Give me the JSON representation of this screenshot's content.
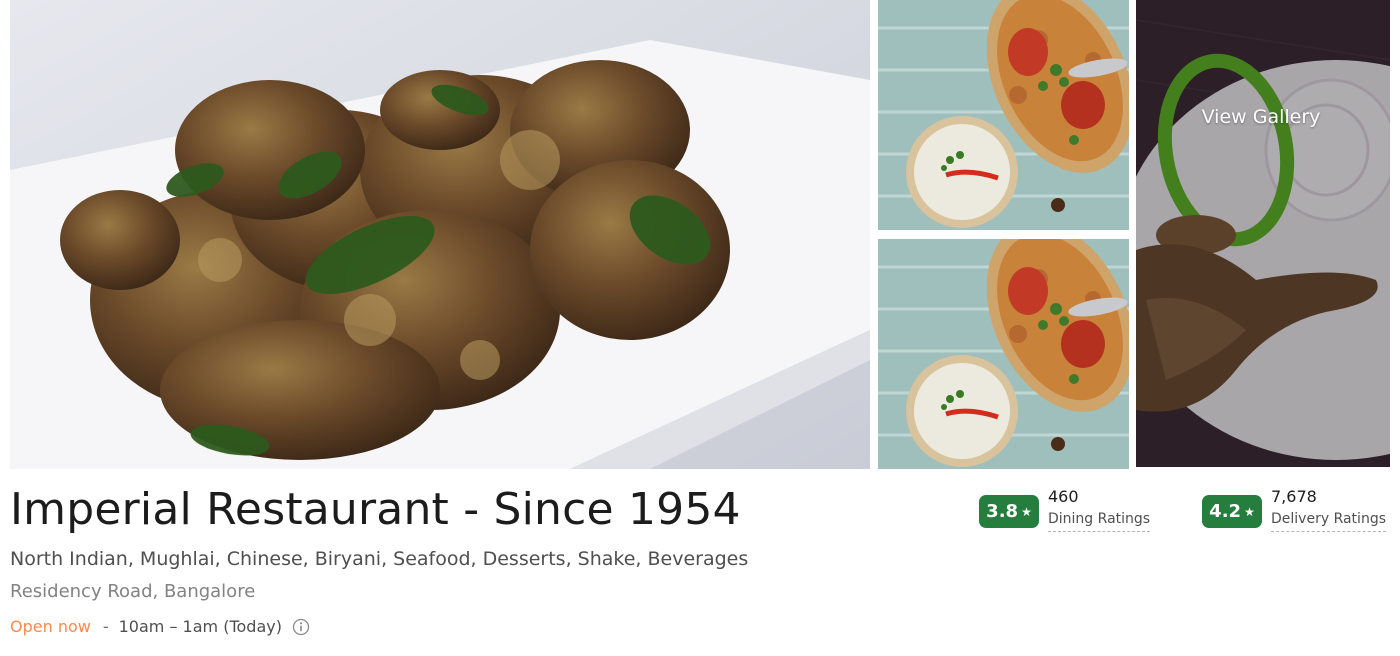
{
  "gallery": {
    "photos": [
      {
        "icon": "food-photo-chicken-fry"
      },
      {
        "icon": "food-photo-biryani"
      },
      {
        "icon": "food-photo-biryani"
      },
      {
        "icon": "food-photo-tandoori-leg"
      }
    ],
    "view_gallery_label": "View Gallery"
  },
  "restaurant": {
    "name": "Imperial Restaurant - Since 1954",
    "cuisines": "North Indian, Mughlai, Chinese, Biryani, Seafood, Desserts, Shake, Beverages",
    "location": "Residency Road, Bangalore",
    "open_status": "Open now",
    "separator": "-",
    "hours": "10am – 1am (Today)",
    "info_icon": "info-icon"
  },
  "ratings": {
    "dining": {
      "score": "3.8",
      "star": "★",
      "count": "460",
      "label": "Dining Ratings"
    },
    "delivery": {
      "score": "4.2",
      "star": "★",
      "count": "7,678",
      "label": "Delivery Ratings"
    }
  },
  "colors": {
    "rating_badge": "#267e3e",
    "open_status": "#f78b4c",
    "title": "#1c1c1c"
  }
}
